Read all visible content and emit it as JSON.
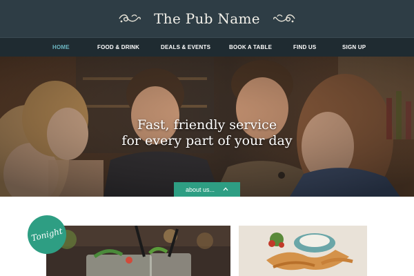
{
  "header": {
    "title": "The Pub Name",
    "background": "#2e3d45"
  },
  "nav": {
    "items": [
      {
        "label": "HOME",
        "active": true
      },
      {
        "label": "FOOD & DRINK",
        "active": false
      },
      {
        "label": "DEALS & EVENTS",
        "active": false
      },
      {
        "label": "BOOK A TABLE",
        "active": false
      },
      {
        "label": "FIND US",
        "active": false
      },
      {
        "label": "SIGN UP",
        "active": false
      }
    ],
    "active_color": "#6db8c4",
    "background": "#1f2b31"
  },
  "hero": {
    "headline_line1": "Fast, friendly service",
    "headline_line2": "for every part of your day",
    "button_label": "about us...",
    "button_icon": "chevron-up-icon",
    "accent": "#2e9e83"
  },
  "promo": {
    "badge_label": "Tonight",
    "left_card_image": "cocktails-photo",
    "right_card_image": "fried-shrimp-photo"
  }
}
